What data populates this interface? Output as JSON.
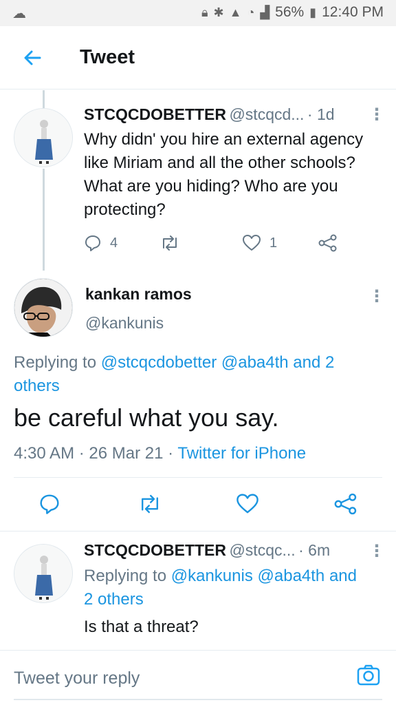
{
  "status_bar": {
    "battery": "56%",
    "time": "12:40 PM"
  },
  "header": {
    "title": "Tweet"
  },
  "tweet1": {
    "name": "STCQCDOBETTER",
    "handle": "@stcqcd...",
    "time": "· 1d",
    "lines": [
      "Why didn' you hire an external agency",
      "like Miriam and all the other schools?",
      "What are you hiding? Who are you",
      "protecting?"
    ],
    "replies": "4",
    "likes": "1"
  },
  "main_tweet": {
    "name": "kankan ramos",
    "handle": "@kankunis",
    "replying_prefix": "Replying to",
    "replying_mentions": "@stcqcdobetter @aba4th and 2",
    "replying_others": "others",
    "text": "be careful what you say.",
    "time": "4:30 AM",
    "date": "26 Mar 21",
    "source": "Twitter for iPhone"
  },
  "reply_tweet": {
    "name": "STCQCDOBETTER",
    "handle": "@stcqc...",
    "time": "· 6m",
    "replying_prefix": "Replying to",
    "replying_mentions": "@kankunis @aba4th and",
    "replying_others": "2 others",
    "text": "Is that a threat?"
  },
  "composer": {
    "placeholder": "Tweet your reply"
  },
  "colors": {
    "accent": "#1da1f2",
    "link": "#1b95e0",
    "muted": "#657786"
  },
  "icons": [
    "back-arrow-icon",
    "reply-icon",
    "retweet-icon",
    "like-icon",
    "share-icon",
    "camera-icon",
    "more-icon"
  ]
}
